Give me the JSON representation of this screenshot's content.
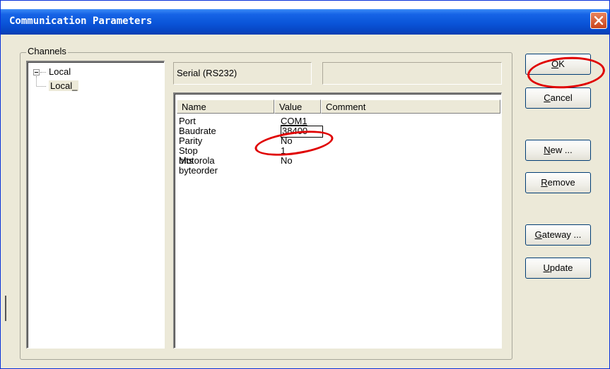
{
  "window": {
    "title": "Communication Parameters",
    "close_icon": "close-icon"
  },
  "channels": {
    "label": "Channels",
    "tree": [
      {
        "label": "Local",
        "expanded": true
      },
      {
        "label": "Local_",
        "selected": true
      }
    ]
  },
  "fields": {
    "protocol": "Serial (RS232)",
    "extra": ""
  },
  "table": {
    "columns": [
      "Name",
      "Value",
      "Comment"
    ],
    "rows": [
      {
        "name": "Port",
        "value": "COM1",
        "comment": ""
      },
      {
        "name": "Baudrate",
        "value": "38400",
        "comment": ""
      },
      {
        "name": "Parity",
        "value": "No",
        "comment": ""
      },
      {
        "name": "Stop bits",
        "value": "1",
        "comment": ""
      },
      {
        "name": "Motorola byteorder",
        "value": "No",
        "comment": ""
      }
    ]
  },
  "buttons": {
    "ok": {
      "mnemonic": "O",
      "rest": "K"
    },
    "cancel": {
      "mnemonic": "C",
      "rest": "ancel"
    },
    "new": {
      "mnemonic": "N",
      "rest": "ew ..."
    },
    "remove": {
      "mnemonic": "R",
      "rest": "emove"
    },
    "gateway": {
      "mnemonic": "G",
      "rest": "ateway ..."
    },
    "update": {
      "mnemonic": "U",
      "rest": "pdate"
    }
  },
  "colors": {
    "title_bar": "#0a55d9",
    "dialog_bg": "#ece9d8",
    "annotation": "#e00000"
  }
}
